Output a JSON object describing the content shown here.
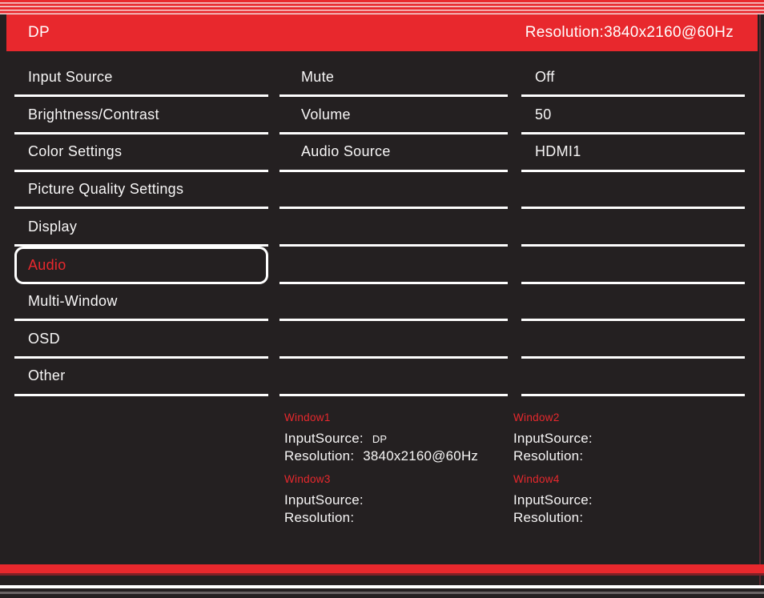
{
  "header": {
    "source": "DP",
    "resolution": "Resolution:3840x2160@60Hz"
  },
  "menu": {
    "items": [
      {
        "label": "Input Source",
        "selected": false
      },
      {
        "label": "Brightness/Contrast",
        "selected": false
      },
      {
        "label": "Color Settings",
        "selected": false
      },
      {
        "label": "Picture Quality Settings",
        "selected": false
      },
      {
        "label": "Display",
        "selected": false
      },
      {
        "label": "Audio",
        "selected": true
      },
      {
        "label": "Multi-Window",
        "selected": false
      },
      {
        "label": "OSD",
        "selected": false
      },
      {
        "label": "Other",
        "selected": false
      }
    ]
  },
  "settings": {
    "rows": [
      {
        "name": "Mute",
        "value": "Off"
      },
      {
        "name": "Volume",
        "value": "50"
      },
      {
        "name": "Audio Source",
        "value": "HDMI1"
      },
      {
        "name": "",
        "value": ""
      },
      {
        "name": "",
        "value": ""
      },
      {
        "name": "",
        "value": ""
      },
      {
        "name": "",
        "value": ""
      },
      {
        "name": "",
        "value": ""
      },
      {
        "name": "",
        "value": ""
      }
    ]
  },
  "windows": [
    {
      "title": "Window1",
      "input_label": "InputSource:",
      "input_value": "DP",
      "resolution_label": "Resolution:",
      "resolution_value": "3840x2160@60Hz"
    },
    {
      "title": "Window2",
      "input_label": "InputSource:",
      "input_value": "",
      "resolution_label": "Resolution:",
      "resolution_value": ""
    },
    {
      "title": "Window3",
      "input_label": "InputSource:",
      "input_value": "",
      "resolution_label": "Resolution:",
      "resolution_value": ""
    },
    {
      "title": "Window4",
      "input_label": "InputSource:",
      "input_value": "",
      "resolution_label": "Resolution:",
      "resolution_value": ""
    }
  ],
  "colors": {
    "accent_red": "#e8282d",
    "background": "#242021",
    "text": "#ffffff"
  }
}
